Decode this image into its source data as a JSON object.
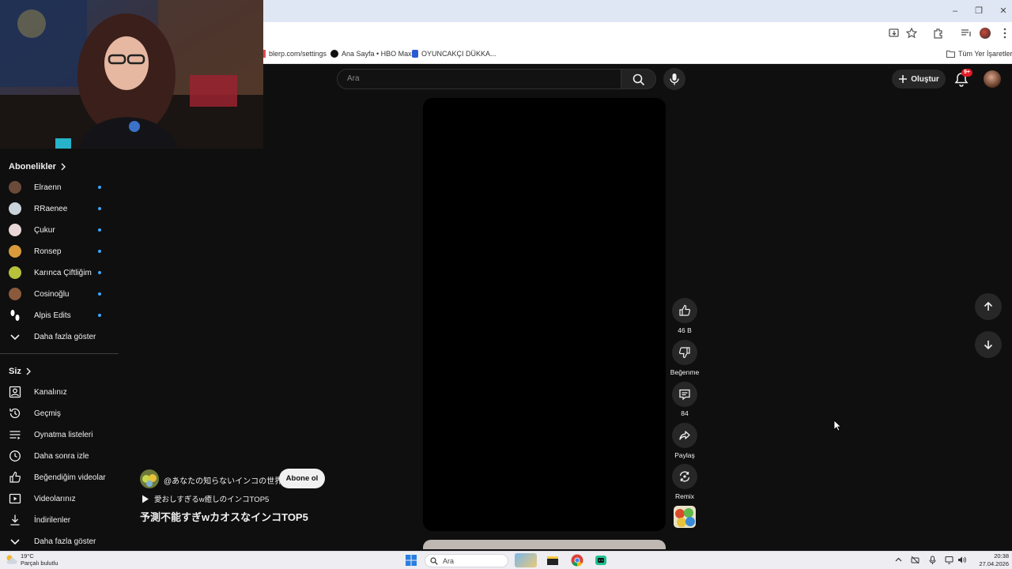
{
  "browser": {
    "bookmarks": [
      {
        "label": "blerp.com/settings"
      },
      {
        "label": "Ana Sayfa • HBO Max"
      },
      {
        "label": "OYUNCAKÇI DÜKKA..."
      }
    ],
    "all_bookmarks_label": "Tüm Yer İşaretleri"
  },
  "header": {
    "search_placeholder": "Ara",
    "create_label": "Oluştur",
    "notification_count": "9+"
  },
  "sidebar": {
    "subscriptions_title": "Abonelikler",
    "subscriptions": [
      {
        "name": "Elraenn",
        "color": "#6b4a3a"
      },
      {
        "name": "RRaenee",
        "color": "#c9d3da"
      },
      {
        "name": "Çukur",
        "color": "#e9d7d7"
      },
      {
        "name": "Ronsep",
        "color": "#d99a3b"
      },
      {
        "name": "Karınca Çiftliğim",
        "color": "#b5c23a"
      },
      {
        "name": "Cosinoğlu",
        "color": "#8a5a3c"
      },
      {
        "name": "Alpis Edits",
        "color": "#ffffff"
      }
    ],
    "subs_show_more": "Daha fazla göster",
    "you_title": "Siz",
    "you_items": [
      {
        "label": "Kanalınız",
        "icon": "channel-icon"
      },
      {
        "label": "Geçmiş",
        "icon": "history-icon"
      },
      {
        "label": "Oynatma listeleri",
        "icon": "playlist-icon"
      },
      {
        "label": "Daha sonra izle",
        "icon": "clock-icon"
      },
      {
        "label": "Beğendiğim videolar",
        "icon": "thumb-up-icon"
      },
      {
        "label": "Videolarınız",
        "icon": "video-icon"
      },
      {
        "label": "İndirilenler",
        "icon": "download-icon"
      }
    ],
    "you_show_more": "Daha fazla göster"
  },
  "short": {
    "channel": "@あなたの知らないインコの世界",
    "subscribe_label": "Abone ol",
    "sound": "愛おしすぎるw癒しのインコTOP5",
    "title": "予測不能すぎwカオスなインコTOP5"
  },
  "actions": {
    "likes": "46 B",
    "dislike_label": "Beğenme",
    "comments": "84",
    "share_label": "Paylaş",
    "remix_label": "Remix"
  },
  "taskbar": {
    "temperature": "19°C",
    "weather": "Parçalı bulutlu",
    "search_placeholder": "Ara",
    "time": "20:38",
    "date": "27.04.2026"
  },
  "colors": {
    "background": "#0f0f0f",
    "accent_blue": "#3ea6ff",
    "notification_red": "#e01a23"
  }
}
